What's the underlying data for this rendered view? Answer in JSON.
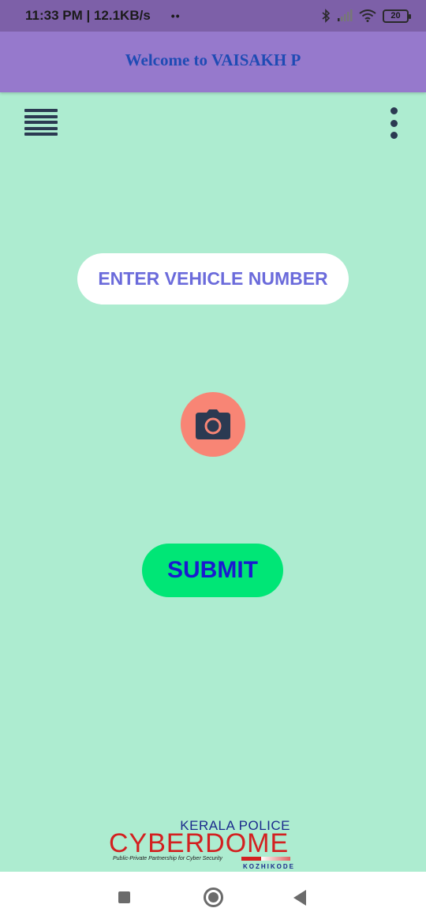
{
  "status_bar": {
    "time": "11:33 PM",
    "network_speed": "12.1KB/s",
    "notification_dots": "••",
    "battery_level": "20",
    "icons": [
      "bluetooth-icon",
      "signal-icon",
      "wifi-icon",
      "battery-icon"
    ]
  },
  "header": {
    "title": "Welcome to VAISAKH P",
    "background_color": "#9679cc",
    "title_color": "#1f4bb4"
  },
  "toolbar": {
    "menu_icon": "hamburger-menu-icon",
    "more_icon": "more-vertical-icon"
  },
  "form": {
    "vehicle_number_placeholder": "ENTER VEHICLE NUMBER",
    "vehicle_number_value": "",
    "camera_icon": "camera-icon",
    "submit_label": "SUBMIT"
  },
  "footer_logo": {
    "line1": "KERALA POLICE",
    "line2": "CYBERDOME",
    "tagline": "Public-Private Partnership for Cyber Security",
    "location": "KOZHIKODE"
  },
  "nav_bar": {
    "icons": [
      "recents-square-icon",
      "home-circle-icon",
      "back-triangle-icon"
    ]
  },
  "colors": {
    "background": "#adecd0",
    "camera_button": "#f88575",
    "submit_button": "#00e676",
    "submit_text": "#1a1ad0",
    "placeholder_text": "#6b6bdb"
  }
}
